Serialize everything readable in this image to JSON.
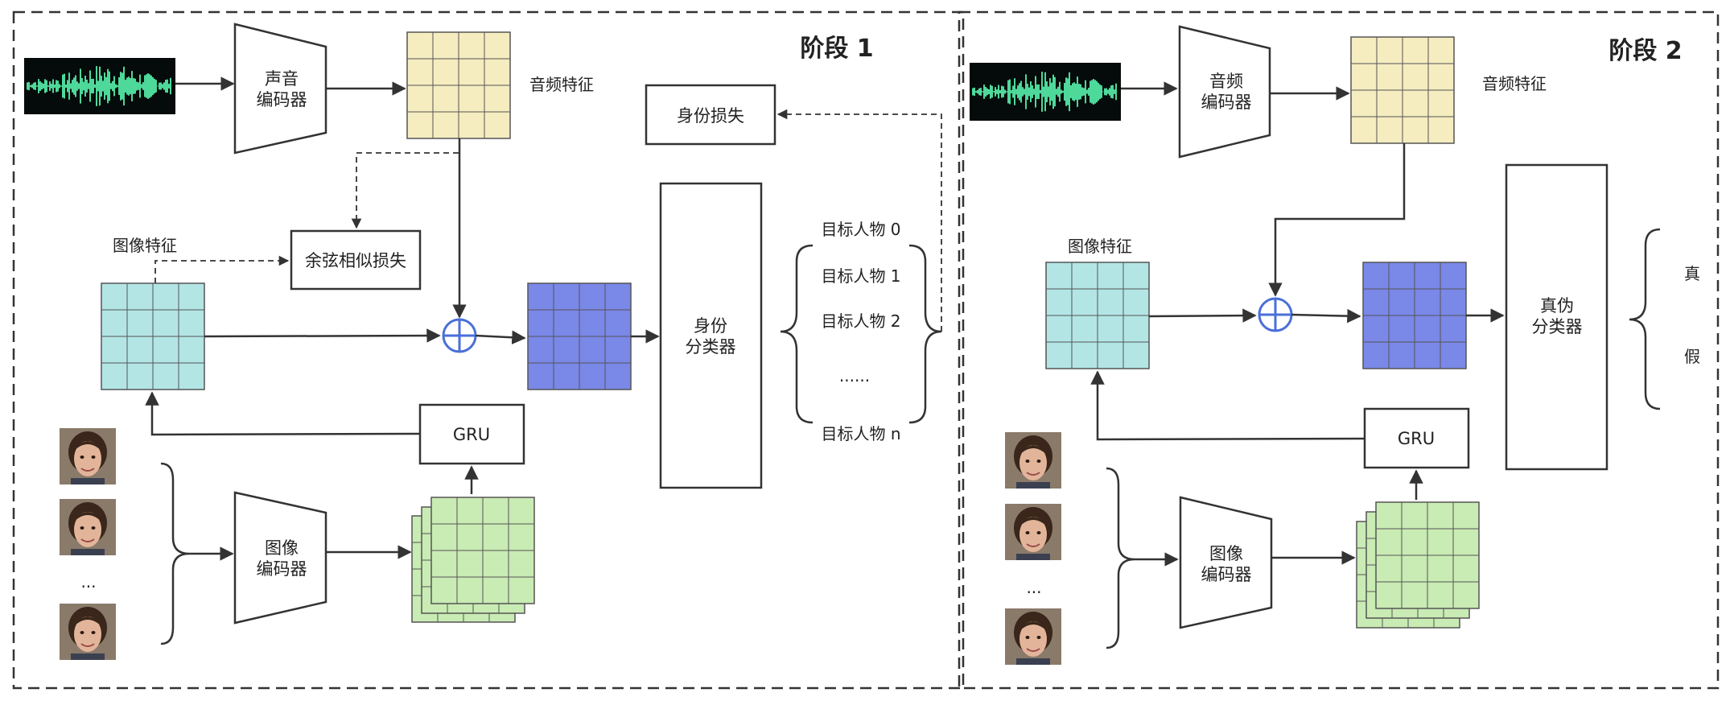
{
  "stage1": {
    "title": "阶段 1",
    "voice_encoder": [
      "声音",
      "编码器"
    ],
    "audio_feature_label": "音频特征",
    "identity_loss": "身份损失",
    "cosine_loss": "余弦相似损失",
    "image_feature_label": "图像特征",
    "identity_classifier": [
      "身份",
      "分类器"
    ],
    "targets": [
      "目标人物  0",
      "目标人物  1",
      "目标人物  2",
      "......",
      "目标人物  n"
    ],
    "gru": "GRU",
    "image_encoder": [
      "图像",
      "编码器"
    ],
    "frames_ellipsis": "..."
  },
  "stage2": {
    "title": "阶段 2",
    "audio_encoder": [
      "音频",
      "编码器"
    ],
    "audio_feature_label": "音频特征",
    "image_feature_label": "图像特征",
    "real_fake_classifier": [
      "真伪",
      "分类器"
    ],
    "outputs": [
      "真",
      "假"
    ],
    "gru": "GRU",
    "image_encoder": [
      "图像",
      "编码器"
    ],
    "frames_ellipsis": "..."
  },
  "colors": {
    "audio_feature": "#f5ecc0",
    "image_feature": "#b3e5e5",
    "fused_feature": "#7a88e8",
    "video_feature": "#c9ebb4",
    "plus_circle": "#4a6fd9",
    "waveform": "#4ed89a",
    "waveform_bg": "#050a0a",
    "face_bg": "#8a7a6a"
  },
  "icons": {
    "waveform": "audio-waveform-icon",
    "face": "face-photo-icon",
    "plus": "add-circle-icon"
  }
}
